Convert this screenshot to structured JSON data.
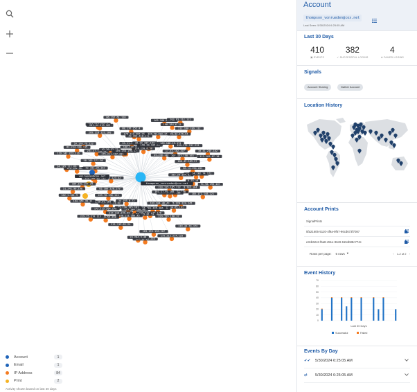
{
  "account": {
    "title": "Account",
    "email": "thompson_vonrueden@cox.net",
    "last_seen": "Last Seen: 5/30/2024 6:25:05 AM"
  },
  "last30": {
    "title": "Last 30 Days",
    "events": {
      "value": "410",
      "label": "EVENTS"
    },
    "successful": {
      "value": "382",
      "label": "SUCCESSFUL LOGINS"
    },
    "failed": {
      "value": "4",
      "label": "FAILED LOGINS"
    }
  },
  "signals": {
    "title": "Signals",
    "items": [
      "Account Sharing",
      "Gather Account"
    ]
  },
  "location": {
    "title": "Location History"
  },
  "prints": {
    "title": "Account Prints",
    "column": "SignalPrints",
    "rows": [
      "5fa21605-5120-4f9a-9f67-96cd673f7087",
      "e3cb62c2-f6a8-451e-96c9-6154b88c774c"
    ],
    "rows_per_page_label": "Rows per page:",
    "rows_per_page_value": "5 rows",
    "range": "1-2 of 2"
  },
  "event_history": {
    "title": "Event History",
    "xlabel": "Last 30 Days",
    "legend_success": "Successful",
    "legend_failed": "Failed"
  },
  "events_by_day": {
    "title": "Events By Day",
    "rows": [
      "5/30/2024 6:25:05 AM",
      "5/30/2024 6:25:05 AM"
    ]
  },
  "legend": {
    "items": [
      {
        "label": "Account",
        "count": "1",
        "color": "#1e63b8"
      },
      {
        "label": "Email",
        "count": "1",
        "color": "#1e63b8"
      },
      {
        "label": "IP Address",
        "count": "84",
        "color": "#f47b20"
      },
      {
        "label": "Print",
        "count": "2",
        "color": "#f5b324"
      }
    ],
    "note": "Activity shown based on last 30 days"
  },
  "graph": {
    "center_label": "thompson_vonrueden@cox.net",
    "email_label": "vonrueden@cox.net",
    "ip_labels": [
      "213.231.88.14",
      "182.29.164.55",
      "9.75.19",
      "91.98.196.107",
      "159.89.143.104",
      "185.171.148.221",
      "193.115.195.232",
      "186.96.104.148",
      "213.62.114.196",
      "115.224.224.145",
      "161.17.91.108",
      "119.44.74.172",
      "203.34.65.191",
      "163.204.46.49",
      "229.159.198.37",
      "119.48.74.142",
      "175.212.214.125",
      "34.201.195.106",
      "220.247.146.176",
      "183.155.158.207",
      "59.115.81.53",
      "172.12.26.210",
      "24.204.3.48",
      "179.144.168.40",
      "188.111.186.43",
      "211.119.81.24",
      "65.130.185.181",
      "34.195.0.72",
      "217.110.245.99",
      "153.146.55.190",
      "104.178.11.62",
      "172.115.204.179",
      "229.75.210.113",
      "41.20.91.169",
      "209.78.236.112",
      "85.106.130.179",
      "164.169.39.11",
      "162.1.101.9",
      "51.241.96.198",
      "189.161.197.34",
      "100.63.123.42",
      "152.108.93.153",
      "42.122.178.63",
      "121.134.70.106",
      "34.105.111.66",
      "52.151.34.152",
      "58.103.171.98",
      "119.142.223.216",
      "83.234.100.115",
      "201.47.118.32",
      "59.170.79.133",
      "42.20.23.73",
      "175.211.197.201",
      "209.118.133.100",
      "204.213.120.4",
      "201.44.219.169",
      "38.140.85.206",
      "109.254.196.17",
      "66.197.61.126",
      "33.11.149.144",
      "146.140.229.87",
      "88.176.152.4",
      "179.112.207.71",
      "42.204.110.171",
      "36.39.107.194",
      "174.120.8.56",
      "22.11.159.74",
      "190.30.109.65",
      "144.78.203.173",
      "162.186.237.32",
      "190.184.6.15",
      "203.63.212.112",
      "93.33.175.54",
      "169.108.19.174",
      "212.160.209.112",
      "45.236.116.111",
      "17.53.102.207",
      "195.172.131.221",
      "207.133.158.163",
      "30.41.245.182",
      "108.45.189.57",
      "112.189.87.18",
      "56.14.194.203",
      "14.102.74.171"
    ]
  },
  "chart_data": {
    "type": "bar",
    "title": "Event History",
    "xlabel": "Last 30 Days",
    "ylabel": "",
    "ylim": [
      0,
      70
    ],
    "yticks": [
      0,
      10,
      20,
      30,
      40,
      50,
      60,
      70
    ],
    "series": [
      {
        "name": "Successful",
        "color": "#1f72c6",
        "values": [
          20,
          0,
          0,
          0,
          40,
          0,
          0,
          0,
          40,
          0,
          25,
          0,
          40,
          0,
          0,
          0,
          40,
          0,
          0,
          0,
          0,
          40,
          0,
          20,
          0,
          40,
          0,
          0,
          0,
          0,
          20
        ]
      },
      {
        "name": "Failed",
        "color": "#f47b20",
        "values": [
          1,
          0,
          0,
          0,
          1,
          0,
          0,
          0,
          1,
          0,
          0,
          0,
          1,
          0,
          0,
          0,
          1,
          0,
          0,
          0,
          0,
          1,
          0,
          0,
          0,
          1,
          0,
          0,
          0,
          0,
          0
        ]
      }
    ]
  },
  "colors": {
    "accent": "#1e5aa6",
    "ip": "#f47b20",
    "account": "#1e63b8",
    "center": "#29b6f6",
    "print": "#f5b324"
  }
}
